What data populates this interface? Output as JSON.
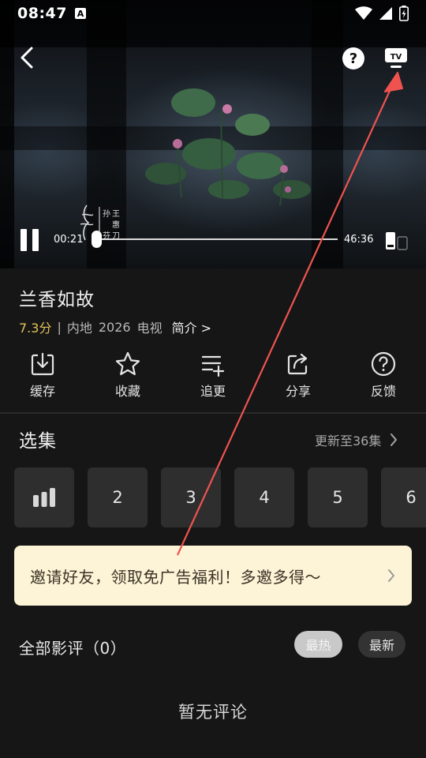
{
  "status_bar": {
    "time": "08:47",
    "notification_badge": "A",
    "icons": [
      "wifi-icon",
      "signal-icon",
      "battery-charging-icon"
    ]
  },
  "player": {
    "current_time": "00:21",
    "total_time": "46:36",
    "progress_fraction": 0.0075,
    "overlay_icons": [
      "back-arrow-icon",
      "help-icon",
      "tv-cast-icon",
      "pause-icon",
      "screen-rotate-icon"
    ],
    "watermark_text": "孙 王 惠 芬 刀"
  },
  "show": {
    "title": "兰香如故",
    "score": "7.3分",
    "separator": "|",
    "region": "内地",
    "year": "2026",
    "category": "电视",
    "intro_label": "简介 >"
  },
  "actions": [
    {
      "label": "缓存",
      "icon": "download-icon"
    },
    {
      "label": "收藏",
      "icon": "star-icon"
    },
    {
      "label": "追更",
      "icon": "playlist-add-icon"
    },
    {
      "label": "分享",
      "icon": "share-icon"
    },
    {
      "label": "反馈",
      "icon": "feedback-help-icon"
    }
  ],
  "episodes": {
    "title": "选集",
    "more_label": "更新至36集",
    "items": [
      "",
      "2",
      "3",
      "4",
      "5",
      "6"
    ],
    "playing_icon": "equalizer-icon"
  },
  "invite_banner": {
    "text": "邀请好友，领取免广告福利！多邀多得～"
  },
  "reviews": {
    "title": "全部影评（0）",
    "sort_hot": "最热",
    "sort_new": "最新",
    "empty_text": "暂无评论"
  },
  "colors": {
    "background": "#161616",
    "score": "#e6c25a",
    "banner": "#fdf3d6",
    "annotation_arrow": "#ef5350"
  }
}
